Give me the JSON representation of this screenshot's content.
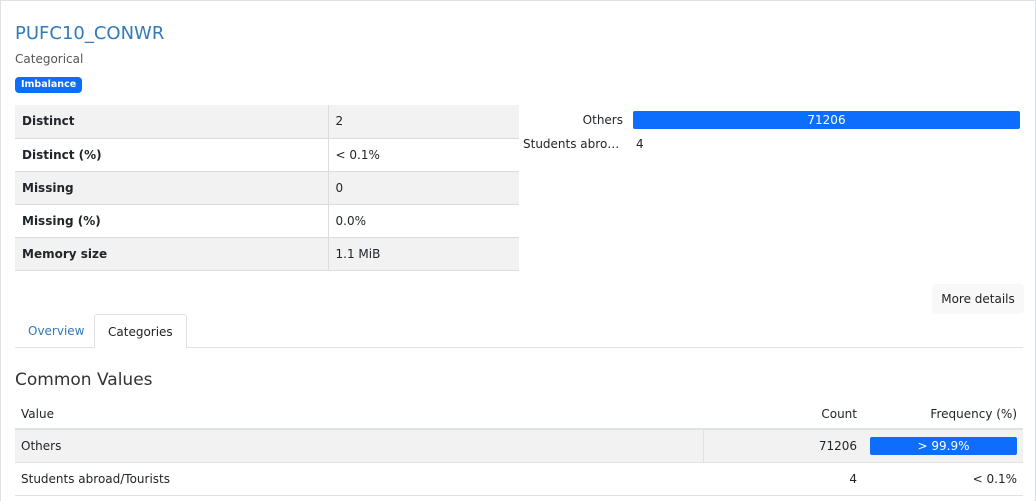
{
  "header": {
    "title": "PUFC10_CONWR",
    "subtitle": "Categorical",
    "badge": "Imbalance"
  },
  "colors": {
    "accent": "#0d6efd",
    "link": "#337ab7",
    "row_alt": "#f2f2f2"
  },
  "stats": [
    {
      "key": "Distinct",
      "value": "2"
    },
    {
      "key": "Distinct (%)",
      "value": "< 0.1%"
    },
    {
      "key": "Missing",
      "value": "0"
    },
    {
      "key": "Missing (%)",
      "value": "0.0%"
    },
    {
      "key": "Memory size",
      "value": "1.1 MiB"
    }
  ],
  "mini_chart": [
    {
      "label": "Others",
      "value": "71206",
      "fraction": 1.0
    },
    {
      "label": "Students abroad/Tourists",
      "value": "4",
      "fraction": 0.0
    }
  ],
  "more_details_label": "More details",
  "tabs": [
    {
      "label": "Overview",
      "active": false
    },
    {
      "label": "Categories",
      "active": true
    }
  ],
  "common_values": {
    "title": "Common Values",
    "columns": {
      "value": "Value",
      "count": "Count",
      "frequency": "Frequency (%)"
    },
    "rows": [
      {
        "value": "Others",
        "count": "71206",
        "frequency": "> 99.9%",
        "fraction": 1.0
      },
      {
        "value": "Students abroad/Tourists",
        "count": "4",
        "frequency": "< 0.1%",
        "fraction": 0.0
      }
    ]
  }
}
